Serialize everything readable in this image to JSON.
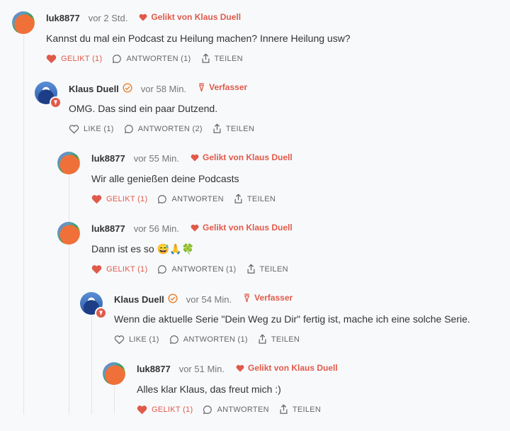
{
  "icons": {
    "like": "heart-icon",
    "reply": "speech-bubble-icon",
    "share": "share-icon",
    "author": "pen-nib-icon",
    "verified": "check-circle-icon"
  },
  "colors": {
    "accent": "#e05a4a",
    "muted": "#666666",
    "background": "#f8f9fb"
  },
  "comments": [
    {
      "author": "luk8877",
      "time": "vor 2 Std.",
      "flag": "Gelikt von Klaus Duell",
      "text": "Kannst du mal ein Podcast zu Heilung machen? Innere Heilung usw?",
      "like_label": "GELIKT (1)",
      "reply_label": "ANTWORTEN (1)",
      "share_label": "TEILEN"
    },
    {
      "author": "Klaus Duell",
      "time": "vor 58 Min.",
      "flag": "Verfasser",
      "text": "OMG. Das sind ein paar Dutzend.",
      "like_label": "LIKE (1)",
      "reply_label": "ANTWORTEN (2)",
      "share_label": "TEILEN"
    },
    {
      "author": "luk8877",
      "time": "vor 55 Min.",
      "flag": "Gelikt von Klaus Duell",
      "text": "Wir alle genießen deine Podcasts",
      "like_label": "GELIKT (1)",
      "reply_label": "ANTWORTEN",
      "share_label": "TEILEN"
    },
    {
      "author": "luk8877",
      "time": "vor 56 Min.",
      "flag": "Gelikt von Klaus Duell",
      "text": "Dann ist es so 😅🙏🍀",
      "like_label": "GELIKT (1)",
      "reply_label": "ANTWORTEN (1)",
      "share_label": "TEILEN"
    },
    {
      "author": "Klaus Duell",
      "time": "vor 54 Min.",
      "flag": "Verfasser",
      "text": "Wenn die aktuelle Serie \"Dein Weg zu Dir\" fertig ist, mache ich eine solche Serie.",
      "like_label": "LIKE (1)",
      "reply_label": "ANTWORTEN (1)",
      "share_label": "TEILEN"
    },
    {
      "author": "luk8877",
      "time": "vor 51 Min.",
      "flag": "Gelikt von Klaus Duell",
      "text": "Alles klar Klaus, das freut mich :)",
      "like_label": "GELIKT (1)",
      "reply_label": "ANTWORTEN",
      "share_label": "TEILEN"
    }
  ]
}
